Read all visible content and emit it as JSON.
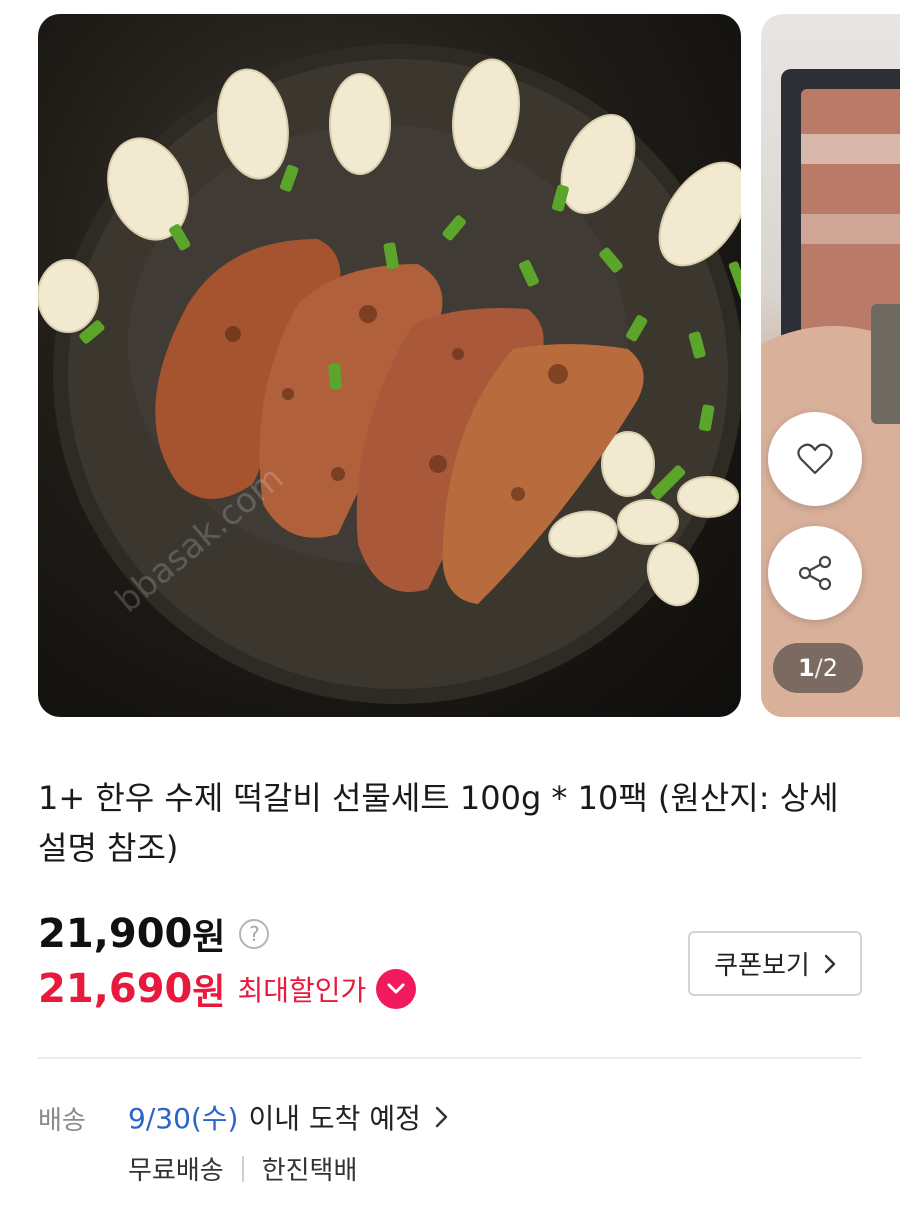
{
  "carousel": {
    "page_current": "1",
    "page_separator": "/",
    "page_total": "2",
    "like_icon": "heart-icon",
    "share_icon": "share-icon"
  },
  "product": {
    "title": "1+ 한우 수제 떡갈비 선물세트 100g * 10팩 (원산지: 상세설명 참조)",
    "price_original": "21,900",
    "price_unit": "원",
    "price_sale": "21,690",
    "max_discount_label": "최대할인가",
    "coupon_button": "쿠폰보기",
    "colors": {
      "sale": "#e8193c",
      "badge": "#f01a5c",
      "link": "#2b65c9"
    }
  },
  "shipping": {
    "label": "배송",
    "date": "9/30(수)",
    "arrival_text": "이내 도착 예정",
    "fee": "무료배송",
    "carrier": "한진택배"
  }
}
